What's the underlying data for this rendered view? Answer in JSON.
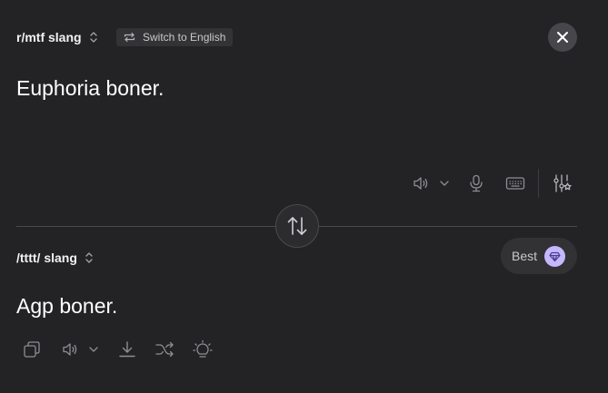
{
  "source": {
    "language": "r/mtf slang",
    "switch_label": "Switch to English",
    "text": "Euphoria boner."
  },
  "target": {
    "language": "/tttt/ slang",
    "text": "Agp boner.",
    "quality_label": "Best"
  },
  "colors": {
    "background": "#232325",
    "icon": "#8e8e93",
    "accent": "#c6b8ff"
  },
  "icons": {
    "close": "close-icon",
    "swap": "swap-arrows-icon",
    "gem": "gem-icon"
  }
}
